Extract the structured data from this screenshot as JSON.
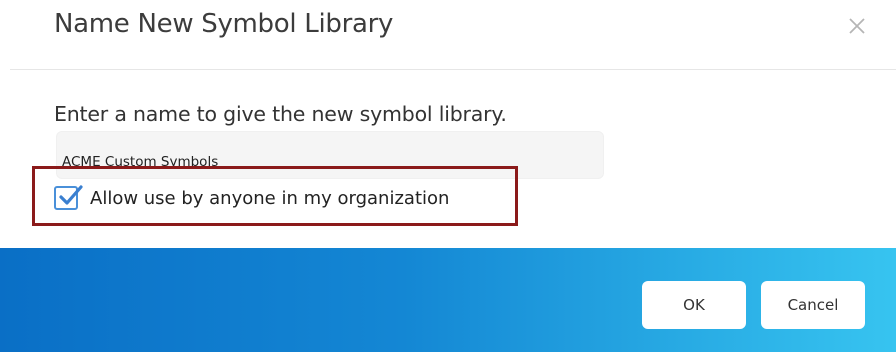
{
  "dialog": {
    "title": "Name New Symbol Library",
    "close_icon": "close-icon",
    "prompt": "Enter a name to give the new symbol library.",
    "name_input": {
      "value": "ACME Custom Symbols"
    },
    "share_checkbox": {
      "label": "Allow use by anyone in my organization",
      "checked": true,
      "icon": "checkmark-icon"
    },
    "buttons": {
      "ok_label": "OK",
      "cancel_label": "Cancel"
    }
  },
  "colors": {
    "highlight_border": "#8b1a1a",
    "footer_gradient_start": "#0a6fc6",
    "footer_gradient_end": "#37c4f0",
    "checkbox_accent": "#4a90d9"
  }
}
